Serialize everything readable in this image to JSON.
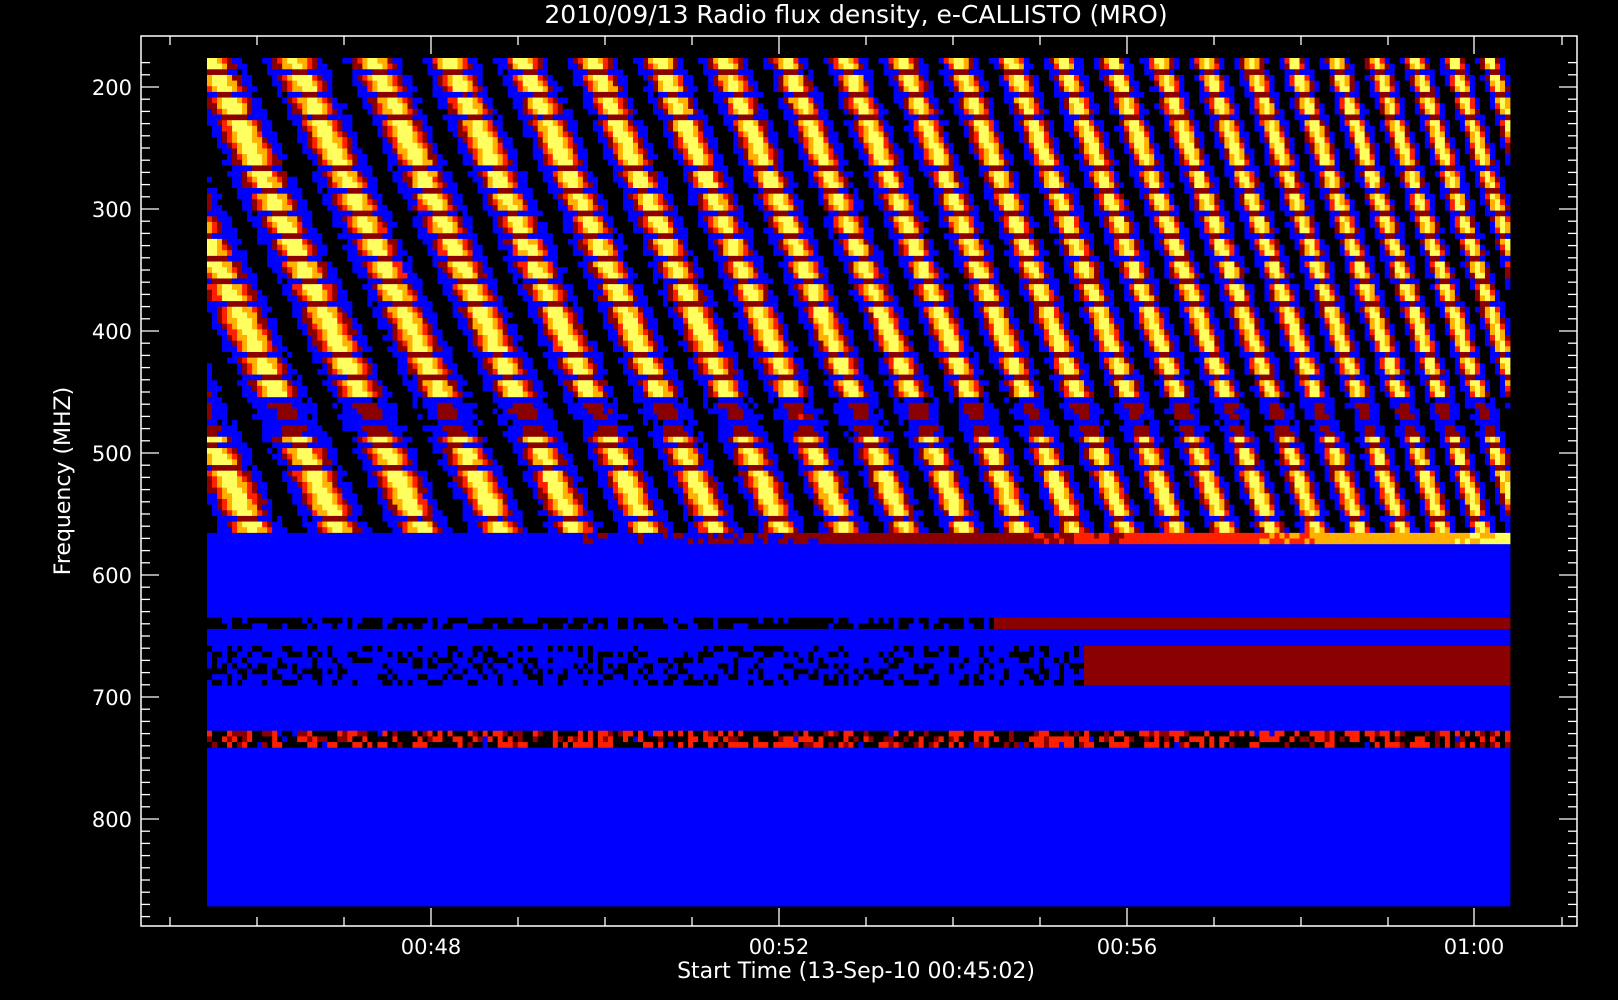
{
  "chart_data": {
    "type": "heatmap",
    "title": "2010/09/13  Radio flux density, e-CALLISTO (MRO)",
    "xlabel": "Start Time (13-Sep-10 00:45:02)",
    "ylabel": "Frequency (MHZ)",
    "x_ticks": [
      "00:48",
      "00:52",
      "00:56",
      "01:00"
    ],
    "y_ticks": [
      "200",
      "300",
      "400",
      "500",
      "600",
      "700",
      "800"
    ],
    "xlim": [
      "00:45:02",
      "01:00:30"
    ],
    "ylim_mhz": [
      870,
      180
    ],
    "y_inverted": true,
    "grid": false,
    "legend": "none",
    "colormap": [
      "#000000",
      "#0000ff",
      "#8b0000",
      "#ff2000",
      "#ffb000",
      "#ffff60"
    ],
    "bands": [
      {
        "f_from": 180,
        "f_to": 565,
        "pattern": "drifting-bursts"
      },
      {
        "f_from": 565,
        "f_to": 575,
        "pattern": "enhanced-line"
      },
      {
        "f_from": 575,
        "f_to": 870,
        "pattern": "background-noise"
      }
    ]
  }
}
